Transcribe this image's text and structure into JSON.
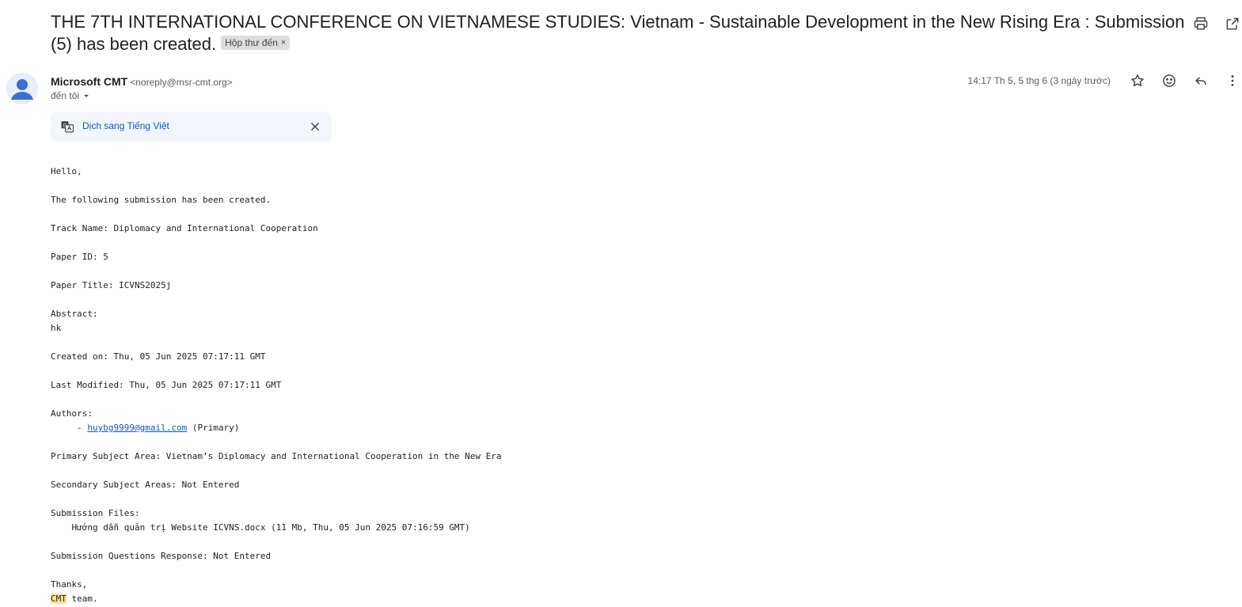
{
  "subject": "THE 7TH INTERNATIONAL CONFERENCE ON VIETNAMESE STUDIES: Vietnam - Sustainable Development in the New Rising Era : Submission (5) has been created.",
  "label_chip": "Hộp thư đến",
  "label_chip_close": "×",
  "top_actions": {
    "print": "printer-icon",
    "open_new_window": "open-in-new-icon"
  },
  "sender": {
    "name": "Microsoft CMT",
    "email": "<noreply@msr-cmt.org>",
    "to": "đến tôi"
  },
  "timestamp": "14:17 Th 5, 5 thg 6 (3 ngày trước)",
  "header_actions": [
    "star-icon",
    "emoji-icon",
    "reply-icon",
    "more-vert-icon"
  ],
  "translate": {
    "link": "Dịch sang Tiếng Việt"
  },
  "body": {
    "greeting": "Hello,",
    "intro": "The following submission has been created.",
    "track": "Track Name: Diplomacy and International Cooperation",
    "paper_id": "Paper ID: 5",
    "paper_title": "Paper Title: ICVNS2025j",
    "abstract_label": "Abstract:",
    "abstract_value": "hk",
    "created_on": "Created on: Thu, 05 Jun 2025 07:17:11 GMT",
    "last_modified": "Last Modified: Thu, 05 Jun 2025 07:17:11 GMT",
    "authors_label": "Authors:",
    "author_prefix": "     - ",
    "author_email": "huybg9999@gmail.com",
    "author_suffix": " (Primary)",
    "primary_subject": "Primary Subject Area: Vietnam’s Diplomacy and International Cooperation in the New Era",
    "secondary_subject": "Secondary Subject Areas: Not Entered",
    "files_label": "Submission Files:",
    "file_entry": "    Hướng dẫn quản trị Website ICVNS.docx (11 Mb, Thu, 05 Jun 2025 07:16:59 GMT)",
    "questions": "Submission Questions Response: Not Entered",
    "thanks": "Thanks,",
    "sign_highlight": "CMT",
    "sign_rest": " team."
  }
}
